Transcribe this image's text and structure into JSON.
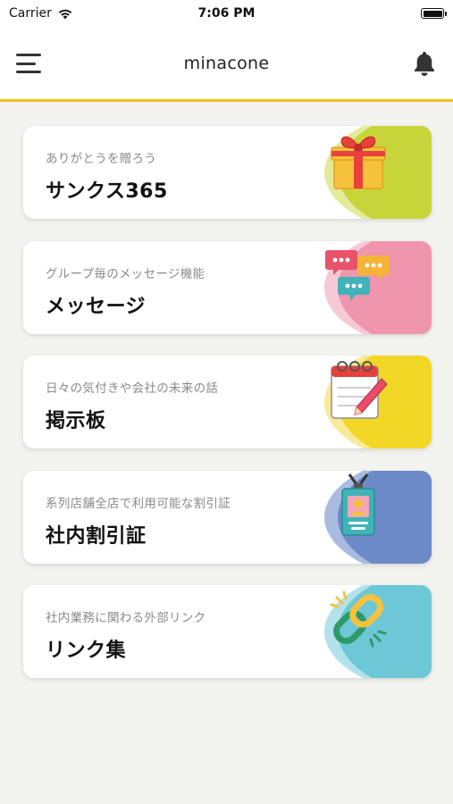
{
  "status_bar": {
    "carrier": "Carrier",
    "time": "7:06 PM"
  },
  "nav": {
    "title": "minacone",
    "menu_icon": "hamburger-menu-icon",
    "bell_icon": "bell-icon"
  },
  "cards": [
    {
      "subtitle": "ありがとうを贈ろう",
      "title": "サンクス365",
      "icon": "gift-icon",
      "color": "#c7d43a",
      "light": "#e3ea9b"
    },
    {
      "subtitle": "グループ毎のメッセージ機能",
      "title": "メッセージ",
      "icon": "chat-bubbles-icon",
      "color": "#ef95ad",
      "light": "#f7c9d5"
    },
    {
      "subtitle": "日々の気付きや会社の未来の話",
      "title": "掲示板",
      "icon": "notepad-pen-icon",
      "color": "#f3d726",
      "light": "#f8ea98"
    },
    {
      "subtitle": "系列店舗全店で利用可能な割引証",
      "title": "社内割引証",
      "icon": "id-badge-icon",
      "color": "#6c8ac8",
      "light": "#a9bbe0"
    },
    {
      "subtitle": "社内業務に関わる外部リンク",
      "title": "リンク集",
      "icon": "chain-link-icon",
      "color": "#6ec7d6",
      "light": "#b3e2ea"
    }
  ]
}
